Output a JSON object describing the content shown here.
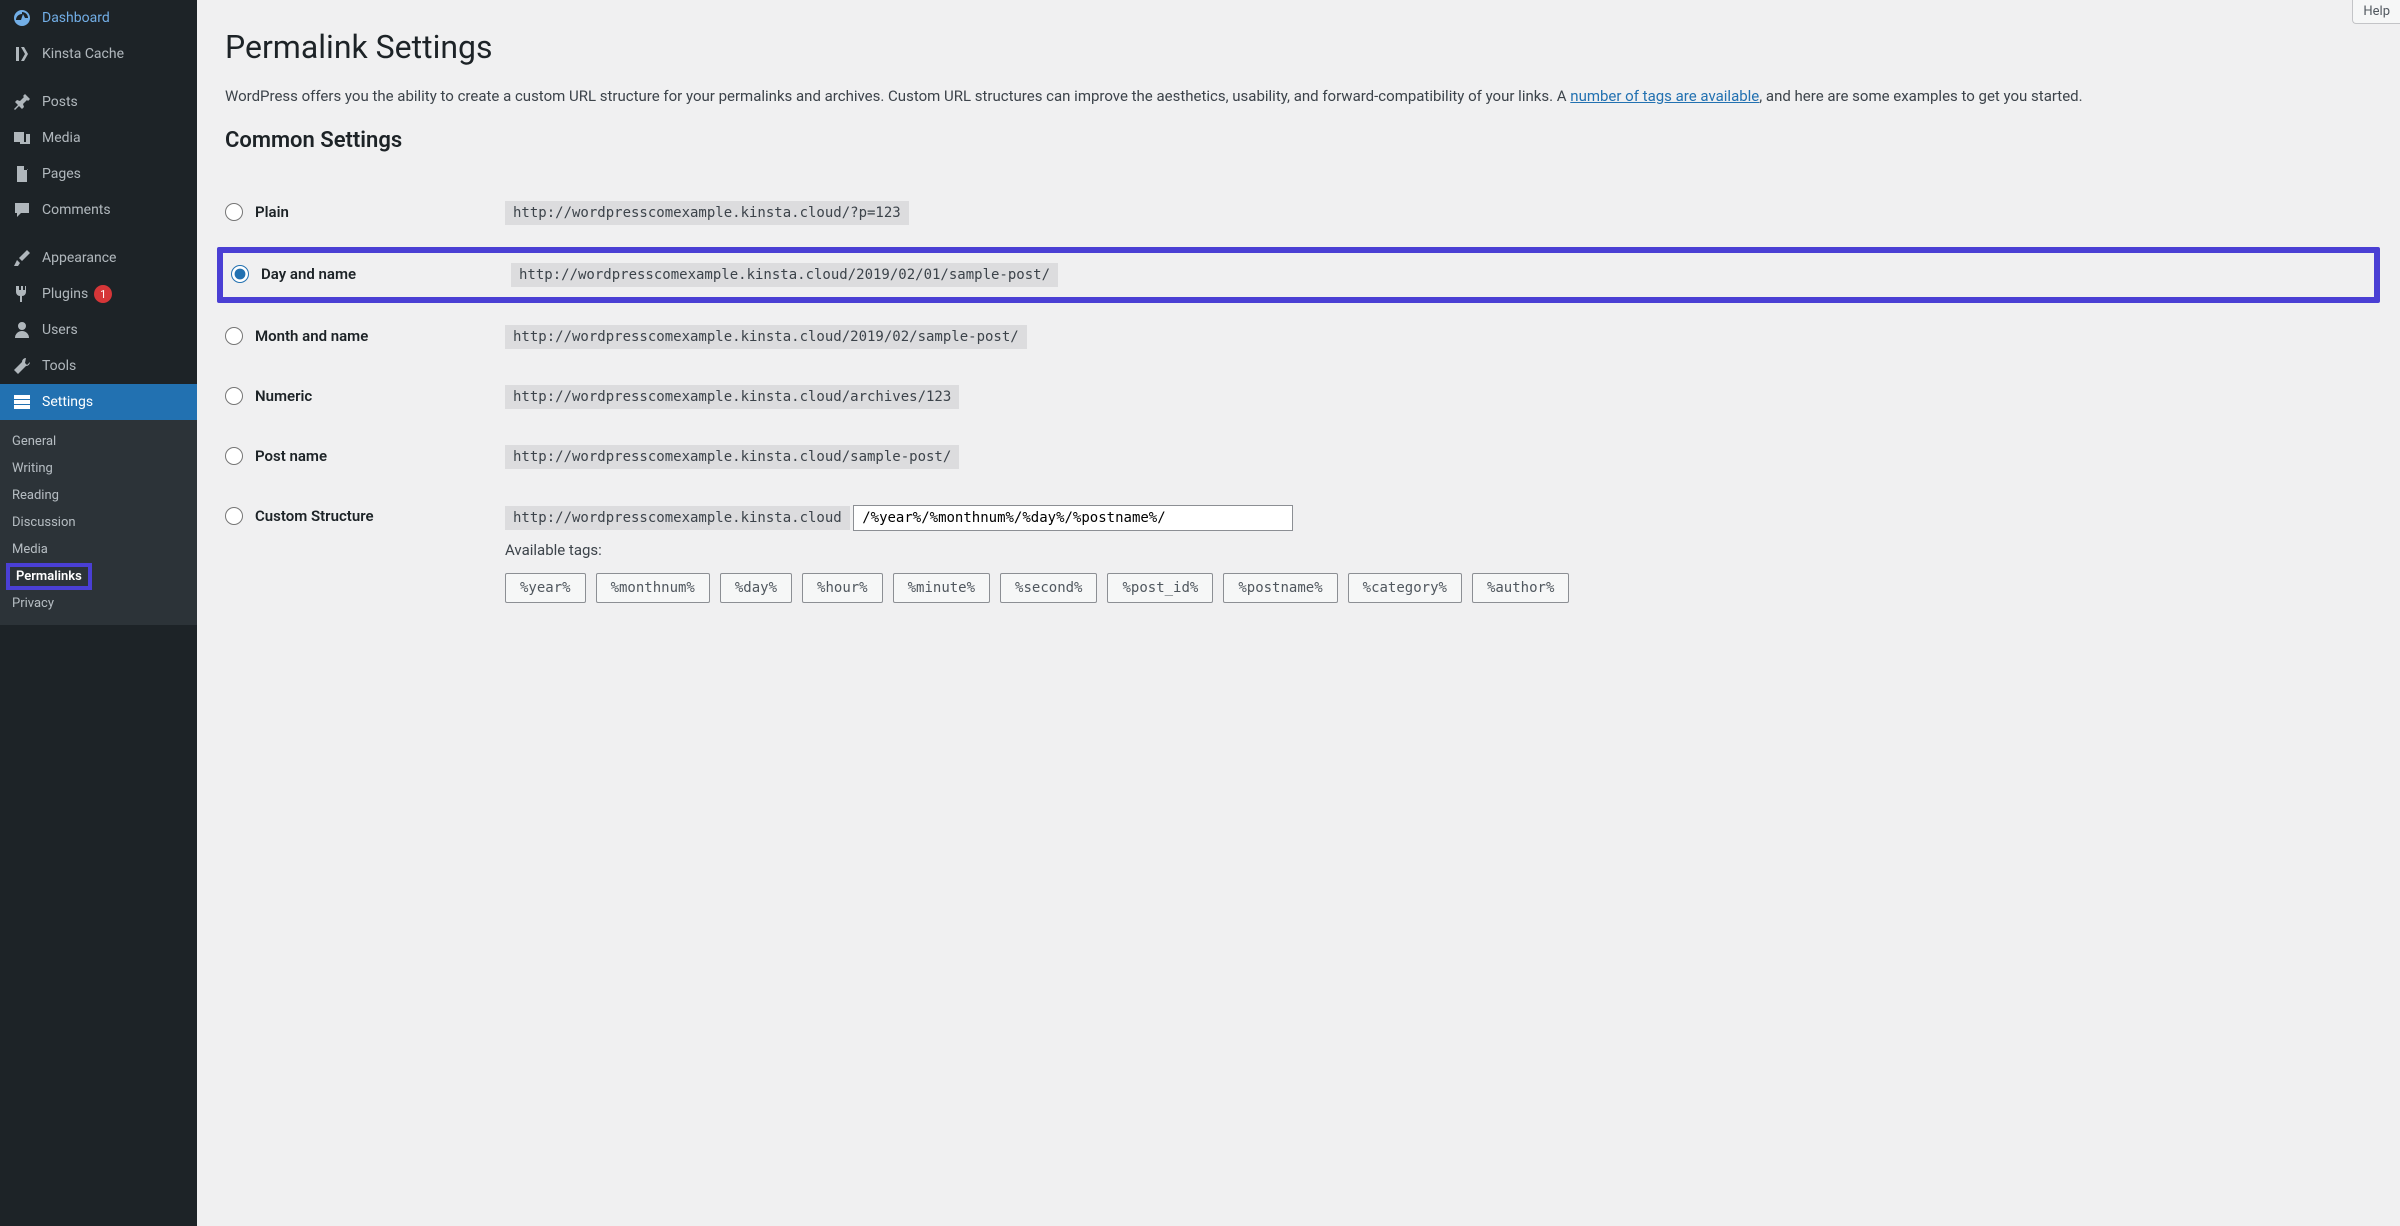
{
  "sidebar": {
    "main": [
      {
        "label": "Dashboard",
        "icon": "dashboard"
      },
      {
        "label": "Kinsta Cache",
        "icon": "kinsta"
      }
    ],
    "content": [
      {
        "label": "Posts",
        "icon": "pin"
      },
      {
        "label": "Media",
        "icon": "media"
      },
      {
        "label": "Pages",
        "icon": "page"
      },
      {
        "label": "Comments",
        "icon": "comment"
      }
    ],
    "admin": [
      {
        "label": "Appearance",
        "icon": "brush"
      },
      {
        "label": "Plugins",
        "icon": "plug",
        "badge": "1"
      },
      {
        "label": "Users",
        "icon": "user"
      },
      {
        "label": "Tools",
        "icon": "wrench"
      },
      {
        "label": "Settings",
        "icon": "settings",
        "active": true
      }
    ],
    "sub": [
      {
        "label": "General"
      },
      {
        "label": "Writing"
      },
      {
        "label": "Reading"
      },
      {
        "label": "Discussion"
      },
      {
        "label": "Media"
      },
      {
        "label": "Permalinks",
        "current": true
      },
      {
        "label": "Privacy"
      }
    ]
  },
  "help_label": "Help",
  "page_title": "Permalink Settings",
  "intro_text_1": "WordPress offers you the ability to create a custom URL structure for your permalinks and archives. Custom URL structures can improve the aesthetics, usability, and forward-compatibility of your links. A ",
  "intro_link": "number of tags are available",
  "intro_text_2": ", and here are some examples to get you started.",
  "common_heading": "Common Settings",
  "options": [
    {
      "key": "plain",
      "label": "Plain",
      "example": "http://wordpresscomexample.kinsta.cloud/?p=123",
      "checked": false,
      "highlighted": false
    },
    {
      "key": "day-name",
      "label": "Day and name",
      "example": "http://wordpresscomexample.kinsta.cloud/2019/02/01/sample-post/",
      "checked": true,
      "highlighted": true
    },
    {
      "key": "month-name",
      "label": "Month and name",
      "example": "http://wordpresscomexample.kinsta.cloud/2019/02/sample-post/",
      "checked": false,
      "highlighted": false
    },
    {
      "key": "numeric",
      "label": "Numeric",
      "example": "http://wordpresscomexample.kinsta.cloud/archives/123",
      "checked": false,
      "highlighted": false
    },
    {
      "key": "post-name",
      "label": "Post name",
      "example": "http://wordpresscomexample.kinsta.cloud/sample-post/",
      "checked": false,
      "highlighted": false
    }
  ],
  "custom": {
    "label": "Custom Structure",
    "base": "http://wordpresscomexample.kinsta.cloud",
    "value": "/%year%/%monthnum%/%day%/%postname%/"
  },
  "available_tags_label": "Available tags:",
  "tags": [
    "%year%",
    "%monthnum%",
    "%day%",
    "%hour%",
    "%minute%",
    "%second%",
    "%post_id%",
    "%postname%",
    "%category%",
    "%author%"
  ]
}
